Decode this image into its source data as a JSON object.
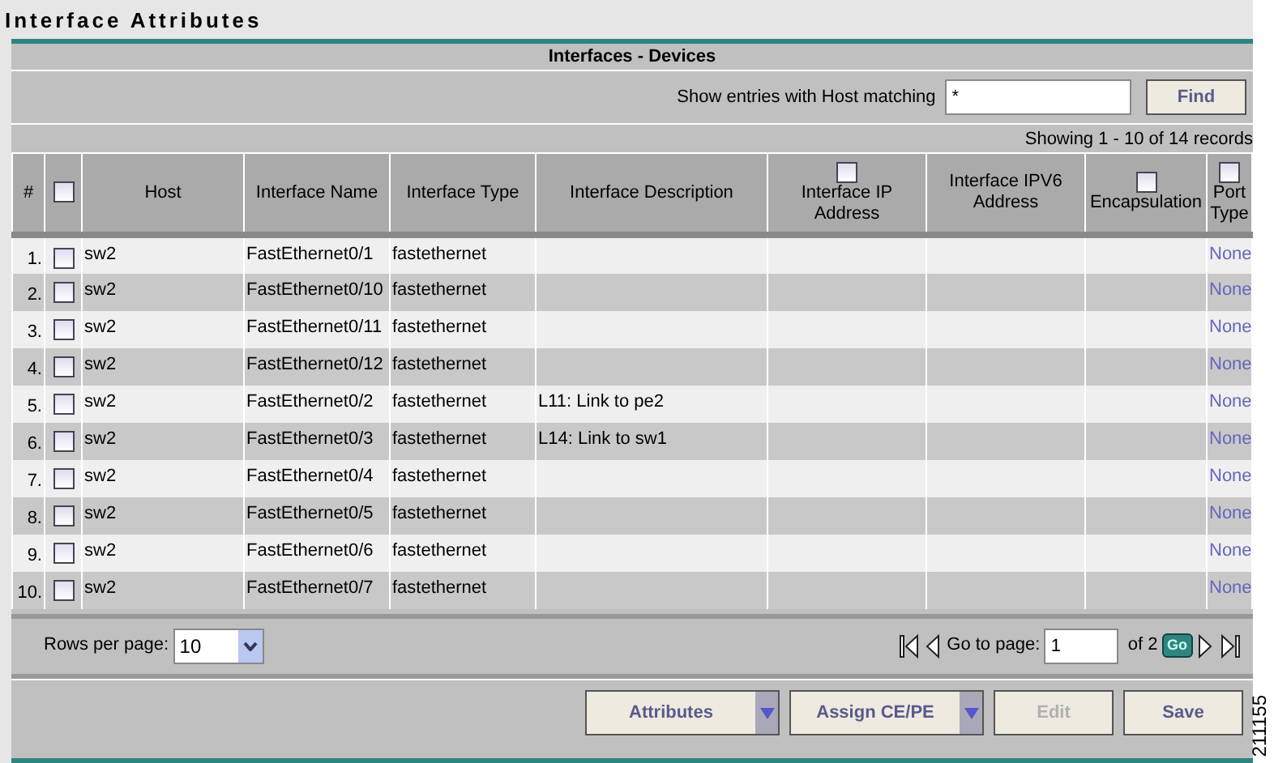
{
  "title": "Interface Attributes",
  "panel": {
    "heading": "Interfaces - Devices",
    "search": {
      "label": "Show entries with Host matching",
      "value": "*",
      "button": "Find"
    },
    "showing": "Showing 1 - 10 of 14 records",
    "columns": [
      {
        "label": "#"
      },
      {
        "kind": "select-all",
        "checked": false
      },
      {
        "label": "Host"
      },
      {
        "label": "Interface Name"
      },
      {
        "label": "Interface Type"
      },
      {
        "label": "Interface Description"
      },
      {
        "label": "Interface IP Address",
        "checked": false
      },
      {
        "label": "Interface IPV6 Address"
      },
      {
        "label": "Encapsulation",
        "checked": false
      },
      {
        "label": "Port Type",
        "checked": false
      }
    ],
    "rows": [
      {
        "index": "1.",
        "checked": false,
        "host": "sw2",
        "name": "FastEthernet0/1",
        "type": "fastethernet",
        "port_type": "None"
      },
      {
        "index": "2.",
        "checked": false,
        "host": "sw2",
        "name": "FastEthernet0/10",
        "type": "fastethernet",
        "port_type": "None"
      },
      {
        "index": "3.",
        "checked": false,
        "host": "sw2",
        "name": "FastEthernet0/11",
        "type": "fastethernet",
        "port_type": "None"
      },
      {
        "index": "4.",
        "checked": false,
        "host": "sw2",
        "name": "FastEthernet0/12",
        "type": "fastethernet",
        "port_type": "None"
      },
      {
        "index": "5.",
        "checked": false,
        "host": "sw2",
        "name": "FastEthernet0/2",
        "type": "fastethernet",
        "description": "L11: Link to pe2",
        "port_type": "None"
      },
      {
        "index": "6.",
        "checked": false,
        "host": "sw2",
        "name": "FastEthernet0/3",
        "type": "fastethernet",
        "description": "L14: Link to sw1",
        "port_type": "None"
      },
      {
        "index": "7.",
        "checked": false,
        "host": "sw2",
        "name": "FastEthernet0/4",
        "type": "fastethernet",
        "port_type": "None"
      },
      {
        "index": "8.",
        "checked": false,
        "host": "sw2",
        "name": "FastEthernet0/5",
        "type": "fastethernet",
        "port_type": "None"
      },
      {
        "index": "9.",
        "checked": false,
        "host": "sw2",
        "name": "FastEthernet0/6",
        "type": "fastethernet",
        "port_type": "None"
      },
      {
        "index": "10.",
        "checked": false,
        "host": "sw2",
        "name": "FastEthernet0/7",
        "type": "fastethernet",
        "port_type": "None"
      }
    ],
    "rows_per_page": {
      "label": "Rows per page:",
      "value": "10"
    },
    "pager": {
      "label": "Go to page:",
      "value": "1",
      "total": "of 2",
      "go": "Go"
    },
    "buttons": [
      {
        "label": "Attributes",
        "kind": "dropdown",
        "disabled": false
      },
      {
        "label": "Assign CE/PE",
        "kind": "dropdown",
        "disabled": false
      },
      {
        "label": "Edit",
        "kind": "plain",
        "disabled": true
      },
      {
        "label": "Save",
        "kind": "plain",
        "disabled": false
      }
    ]
  },
  "figure_number": "211155"
}
